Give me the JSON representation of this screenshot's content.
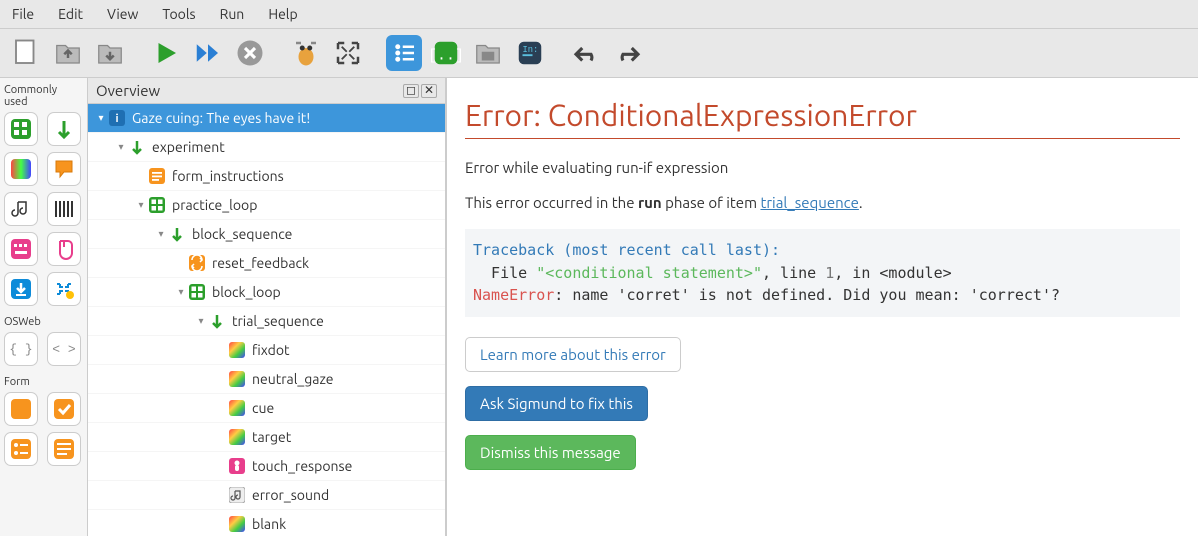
{
  "menubar": [
    "File",
    "Edit",
    "View",
    "Tools",
    "Run",
    "Help"
  ],
  "sidebar": {
    "section1_label": "Commonly used",
    "section2_label": "OSWeb",
    "section3_label": "Form"
  },
  "overview": {
    "title": "Overview",
    "tree": [
      {
        "indent": 0,
        "arrow": "▾",
        "icon": "info",
        "label": "Gaze cuing: The eyes have it!",
        "selected": true
      },
      {
        "indent": 1,
        "arrow": "▾",
        "icon": "seq",
        "label": "experiment"
      },
      {
        "indent": 2,
        "arrow": "",
        "icon": "form",
        "label": "form_instructions"
      },
      {
        "indent": 2,
        "arrow": "▾",
        "icon": "loop",
        "label": "practice_loop"
      },
      {
        "indent": 3,
        "arrow": "▾",
        "icon": "seq",
        "label": "block_sequence"
      },
      {
        "indent": 4,
        "arrow": "",
        "icon": "feedback",
        "label": "reset_feedback"
      },
      {
        "indent": 4,
        "arrow": "▾",
        "icon": "loop",
        "label": "block_loop"
      },
      {
        "indent": 5,
        "arrow": "▾",
        "icon": "seq",
        "label": "trial_sequence"
      },
      {
        "indent": 6,
        "arrow": "",
        "icon": "sketch",
        "label": "fixdot"
      },
      {
        "indent": 6,
        "arrow": "",
        "icon": "sketch",
        "label": "neutral_gaze"
      },
      {
        "indent": 6,
        "arrow": "",
        "icon": "sketch",
        "label": "cue"
      },
      {
        "indent": 6,
        "arrow": "",
        "icon": "sketch",
        "label": "target"
      },
      {
        "indent": 6,
        "arrow": "",
        "icon": "touch",
        "label": "touch_response"
      },
      {
        "indent": 6,
        "arrow": "",
        "icon": "sound",
        "label": "error_sound"
      },
      {
        "indent": 6,
        "arrow": "",
        "icon": "sketch",
        "label": "blank"
      }
    ]
  },
  "error": {
    "title": "Error: ConditionalExpressionError",
    "subtitle": "Error while evaluating run-if expression",
    "phase_pre": "This error occurred in the ",
    "phase_bold": "run",
    "phase_mid": " phase of item ",
    "phase_link": "trial_sequence",
    "phase_end": ".",
    "traceback_head": "Traceback (most recent call last):",
    "tb_file_pre": "  File ",
    "tb_file_q": "\"<conditional statement>\"",
    "tb_file_mid": ", line ",
    "tb_line_no": "1",
    "tb_file_end": ", in <module>",
    "tb_err_name": "NameError",
    "tb_err_msg": ": name 'corret' is not defined. Did you mean: 'correct'?",
    "btn_learn": "Learn more about this error",
    "btn_sigmund": "Ask Sigmund to fix this",
    "btn_dismiss": "Dismiss this message"
  }
}
